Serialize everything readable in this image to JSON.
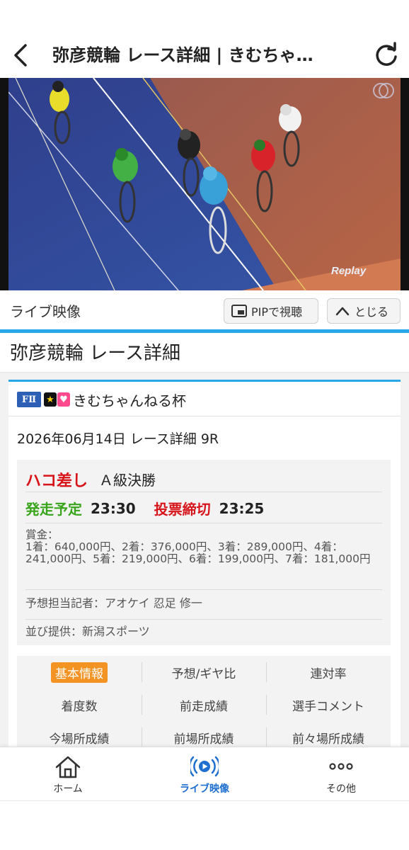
{
  "header": {
    "title": "弥彦競輪 レース詳細 | きむちゃ…",
    "back_icon": "chevron-left-icon",
    "reload_icon": "reload-icon"
  },
  "video": {
    "replay_text": "Replay"
  },
  "live_bar": {
    "label": "ライブ映像",
    "pip_label": "PIPで視聴",
    "close_label": "とじる"
  },
  "page_title": "弥彦競輪 レース詳細",
  "race": {
    "grade_badge": "FⅡ",
    "cup_name": "きむちゃんねる杯",
    "date_line": "2026年06月14日 レース詳細 9R",
    "race_type": "ハコ差し",
    "race_class": "Ａ級決勝",
    "start_label": "発走予定",
    "start_time": "23:30",
    "close_label": "投票締切",
    "close_time": "23:25",
    "prize_label": "賞金：",
    "prize_text": "1着：640,000円、2着：376,000円、3着：289,000円、4着：241,000円、5着：219,000円、6着：199,000円、7着：181,000円",
    "reporter": "予想担当記者：アオケイ 忍足 修一",
    "provider": "並び提供：新潟スポーツ"
  },
  "tabs": [
    {
      "label": "基本情報",
      "active": true
    },
    {
      "label": "予想/ギヤ比"
    },
    {
      "label": "連対率"
    },
    {
      "label": "着度数"
    },
    {
      "label": "前走成績"
    },
    {
      "label": "選手コメント"
    },
    {
      "label": "今場所成績"
    },
    {
      "label": "前場所成績"
    },
    {
      "label": "前々場所成績"
    }
  ],
  "bottom_nav": {
    "home_label": "ホーム",
    "live_label": "ライブ映像",
    "other_label": "その他"
  },
  "colors": {
    "accent_blue": "#27a7e8",
    "red": "#d8141b",
    "green": "#39a51c",
    "orange": "#f39323",
    "nav_active": "#1f6fd0"
  }
}
